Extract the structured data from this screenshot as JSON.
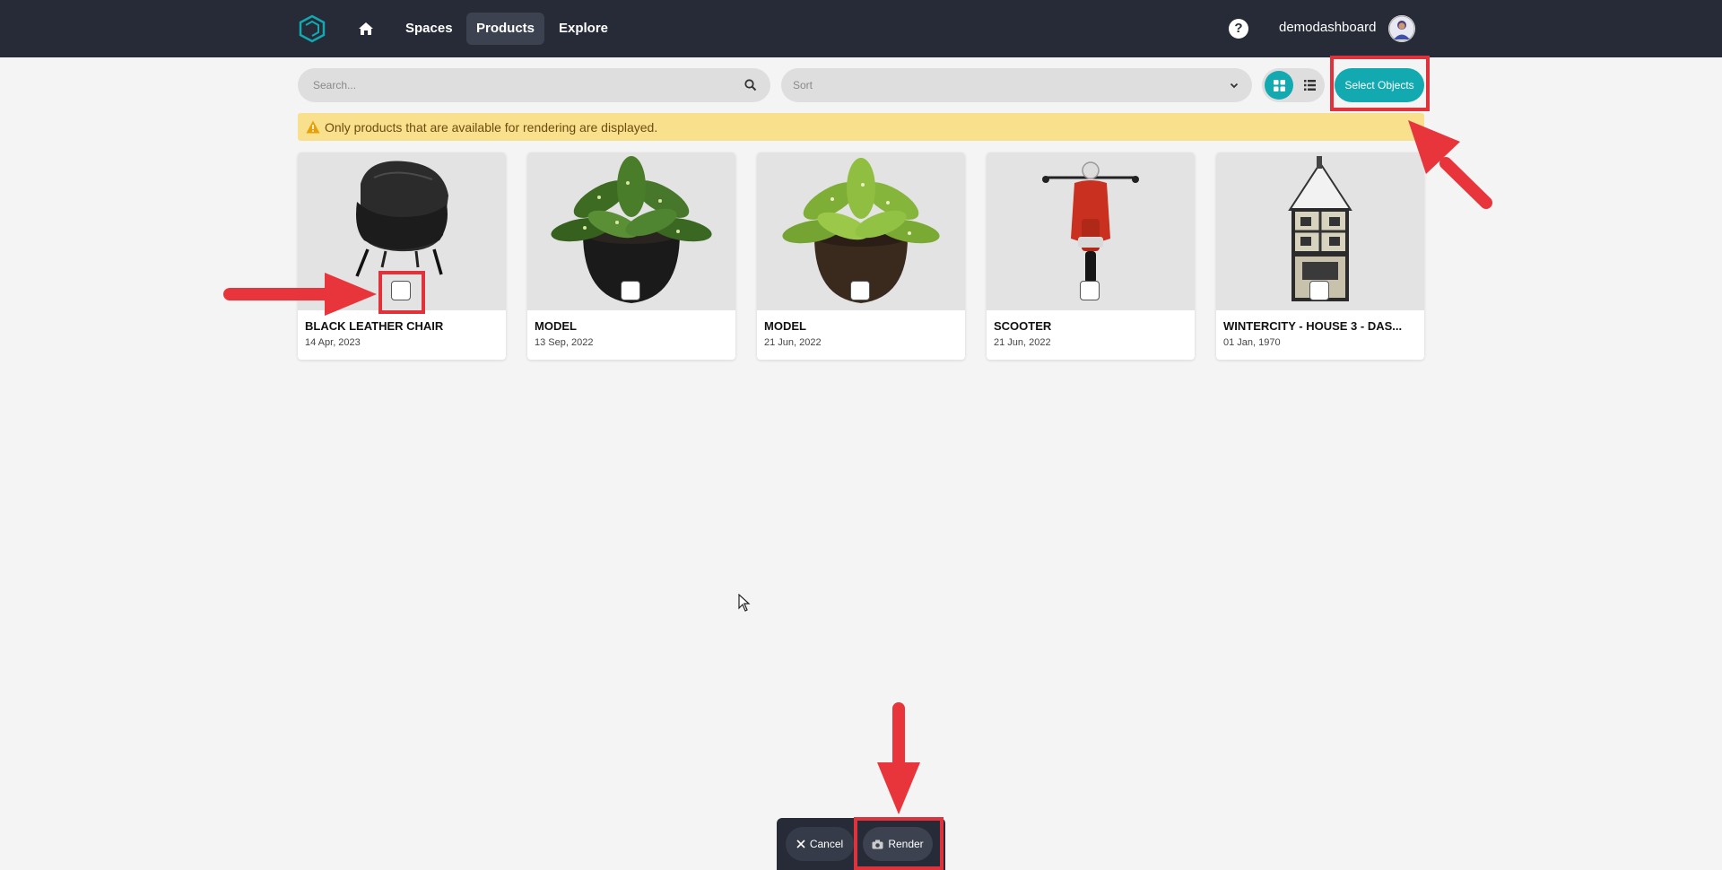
{
  "nav": {
    "home_icon": "home-icon",
    "spaces": "Spaces",
    "products": "Products",
    "explore": "Explore",
    "help": "?",
    "username": "demodashboard"
  },
  "toolbar": {
    "search_placeholder": "Search...",
    "sort_label": "Sort",
    "select_objects": "Select Objects",
    "view_mode": "grid"
  },
  "notice": {
    "text": "Only products that are available for rendering are displayed.",
    "icon": "warning-icon"
  },
  "products": [
    {
      "title": "BLACK LEATHER CHAIR",
      "date": "14 Apr, 2023",
      "image": "black-leather-chair",
      "checked": false
    },
    {
      "title": "MODEL",
      "date": "13 Sep, 2022",
      "image": "potted-plant-variegated",
      "checked": false
    },
    {
      "title": "MODEL",
      "date": "21 Jun, 2022",
      "image": "potted-plant-light",
      "checked": false
    },
    {
      "title": "SCOOTER",
      "date": "21 Jun, 2022",
      "image": "red-scooter",
      "checked": false
    },
    {
      "title": "WINTERCITY - HOUSE 3 - DAS...",
      "date": "01 Jan, 1970",
      "image": "snowy-house",
      "checked": false
    }
  ],
  "bottom_bar": {
    "cancel": "Cancel",
    "render": "Render"
  },
  "colors": {
    "topbar": "#262b37",
    "accent": "#13a9b1",
    "notice_bg": "#f9e08d",
    "annotation": "#e0323a"
  }
}
